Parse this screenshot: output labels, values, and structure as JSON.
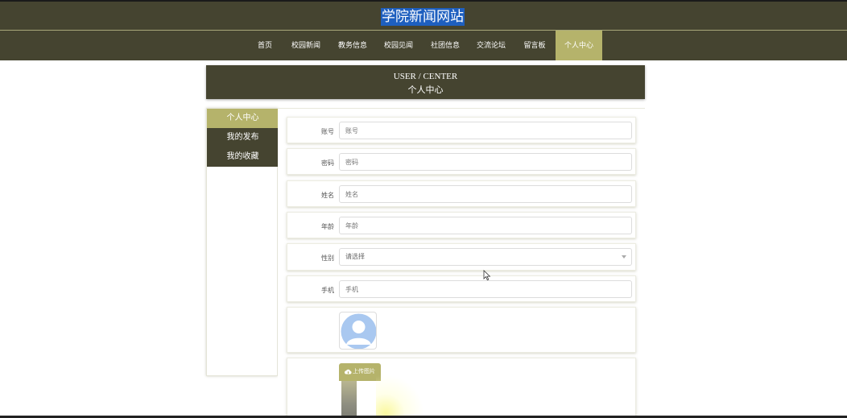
{
  "site": {
    "title": "学院新闻网站"
  },
  "nav": {
    "items": [
      {
        "label": "首页"
      },
      {
        "label": "校园新闻"
      },
      {
        "label": "教务信息"
      },
      {
        "label": "校园见闻"
      },
      {
        "label": "社团信息"
      },
      {
        "label": "交流论坛"
      },
      {
        "label": "留言板"
      },
      {
        "label": "个人中心",
        "active": true
      }
    ]
  },
  "page_header": {
    "en": "USER / CENTER",
    "zh": "个人中心"
  },
  "sidebar": {
    "items": [
      {
        "label": "个人中心",
        "active": true
      },
      {
        "label": "我的发布"
      },
      {
        "label": "我的收藏"
      }
    ]
  },
  "form": {
    "account": {
      "label": "账号",
      "placeholder": "账号",
      "value": ""
    },
    "password": {
      "label": "密码",
      "placeholder": "密码",
      "value": ""
    },
    "name": {
      "label": "姓名",
      "placeholder": "姓名",
      "value": ""
    },
    "age": {
      "label": "年龄",
      "placeholder": "年龄",
      "value": ""
    },
    "gender": {
      "label": "性别",
      "selected": "请选择"
    },
    "phone": {
      "label": "手机",
      "placeholder": "手机",
      "value": ""
    },
    "upload": {
      "button_label": "上传图片",
      "icon": "cloud-upload-icon"
    }
  },
  "colors": {
    "nav_bg": "#454430",
    "accent": "#b5b36b",
    "title_highlight": "#1e5fbf"
  }
}
